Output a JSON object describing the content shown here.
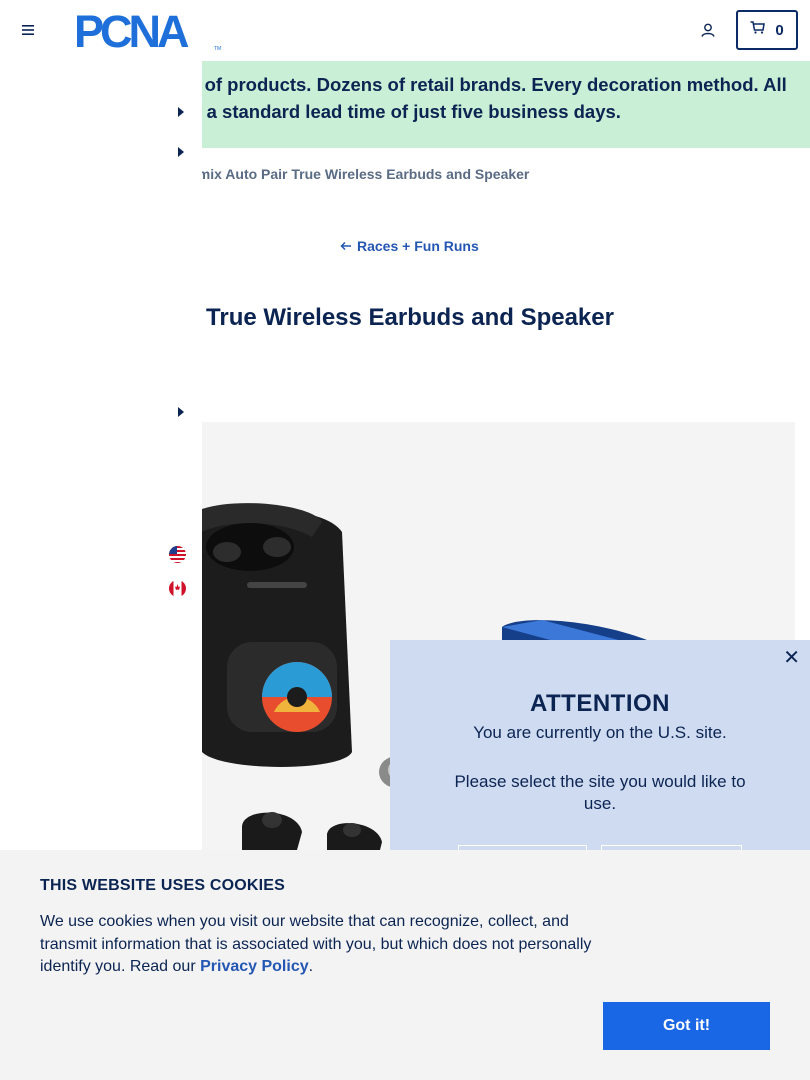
{
  "header": {
    "logo_text": "PCNA",
    "cart_count": "0"
  },
  "promo": {
    "line1": "ls of products. Dozens of retail brands. Every decoration method. All",
    "line2": "th a standard lead time of just five business days."
  },
  "breadcrumb": {
    "current": "emix Auto Pair True Wireless Earbuds and Speaker"
  },
  "back_link": {
    "label": "Races + Fun Runs"
  },
  "product": {
    "title": "True Wireless Earbuds and Speaker"
  },
  "modal": {
    "title": "ATTENTION",
    "line1": "You are currently on the U.S. site.",
    "line2": "Please select the site you would like to use."
  },
  "cookie": {
    "title": "THIS WEBSITE USES COOKIES",
    "text_before": "We use cookies when you visit our website that can recognize, collect, and transmit information that is associated with you, but which does not personally identify you. Read our ",
    "link": "Privacy Policy",
    "text_after": ".",
    "button": "Got it!"
  },
  "colors": {
    "navy": "#0b2452",
    "accent_blue": "#1a67e6",
    "promo_green": "#c9f0d6",
    "modal_bg": "#cfdbf0"
  }
}
